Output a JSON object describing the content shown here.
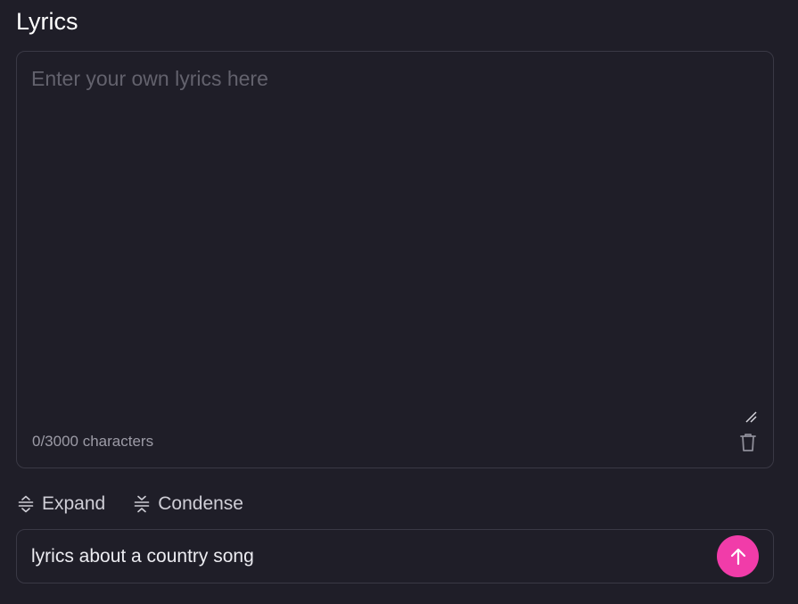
{
  "section": {
    "title": "Lyrics"
  },
  "lyrics": {
    "placeholder": "Enter your own lyrics here",
    "value": "",
    "char_count": "0/3000 characters"
  },
  "tools": {
    "expand_label": "Expand",
    "condense_label": "Condense"
  },
  "prompt": {
    "value": "lyrics about a country song"
  },
  "colors": {
    "background": "#1f1e28",
    "border": "#3a3945",
    "accent": "#f13ca9"
  },
  "icons": {
    "resize": "resize-handle-icon",
    "trash": "trash-icon",
    "expand": "expand-icon",
    "condense": "condense-icon",
    "submit": "arrow-up-icon"
  }
}
